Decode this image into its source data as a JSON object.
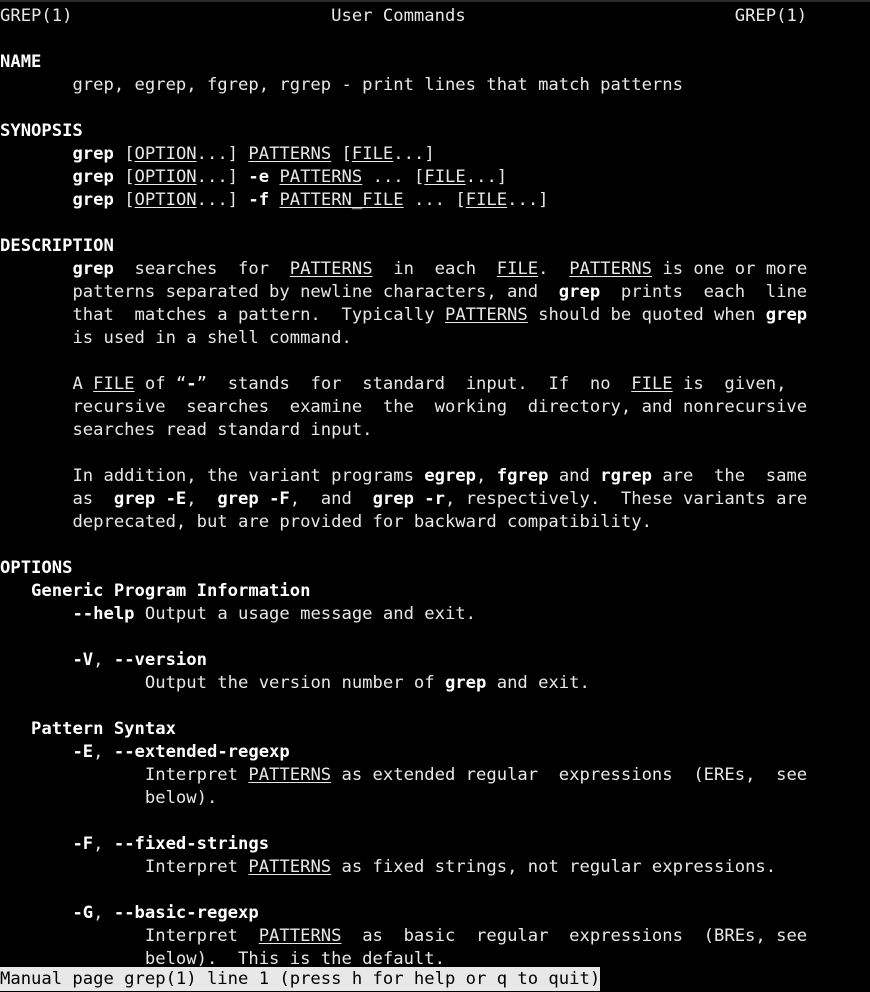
{
  "terminal": {
    "colors": {
      "background": "#000000",
      "foreground": "#e8e8e8",
      "status_background": "#e8e8e8",
      "status_foreground": "#000000"
    },
    "columns": 80,
    "rows": 43
  },
  "manpage": {
    "header": {
      "left": "GREP(1)",
      "center": "User Commands",
      "right": "GREP(1)"
    },
    "sections": {
      "name_heading": "NAME",
      "name_body": "grep, egrep, fgrep, rgrep - print lines that match patterns",
      "synopsis_heading": "SYNOPSIS",
      "description_heading": "DESCRIPTION",
      "options_heading": "OPTIONS",
      "generic_program_information": "Generic Program Information",
      "pattern_syntax": "Pattern Syntax"
    },
    "synopsis": {
      "line1": {
        "cmd": "grep",
        "opt": "OPTION",
        "rest1": "...] ",
        "pat": "PATTERNS",
        "rest2": " [",
        "file": "FILE",
        "rest3": "...]"
      },
      "line2": {
        "cmd": "grep",
        "opt": "OPTION",
        "flag": "-e",
        "pat": "PATTERNS",
        "file": "FILE"
      },
      "line3": {
        "cmd": "grep",
        "opt": "OPTION",
        "flag": "-f",
        "pat": "PATTERN_FILE",
        "file": "FILE"
      }
    },
    "description": {
      "p1": {
        "l1_a": "grep",
        "l1_b": "  searches  for  ",
        "l1_c": "PATTERNS",
        "l1_d": "  in  each  ",
        "l1_e": "FILE",
        "l1_f": ".  ",
        "l1_g": "PATTERNS",
        "l1_h": " is one or more",
        "l2_a": "patterns separated by newline characters, and  ",
        "l2_b": "grep",
        "l2_c": "  prints  each  line",
        "l3_a": "that  matches a pattern.  Typically ",
        "l3_b": "PATTERNS",
        "l3_c": " should be quoted when ",
        "l3_d": "grep",
        "l4_a": "is used in a shell command."
      },
      "p2": {
        "l1_a": "A ",
        "l1_b": "FILE",
        "l1_c": " of “",
        "l1_d": "-",
        "l1_e": "”  stands  for  standard  input.  If  no  ",
        "l1_f": "FILE",
        "l1_g": " is  given,",
        "l2_a": "recursive  searches  examine  the  working  directory, and nonrecursive",
        "l3_a": "searches read standard input."
      },
      "p3": {
        "l1_a": "In addition, the variant programs ",
        "l1_b": "egrep",
        "l1_c": ", ",
        "l1_d": "fgrep",
        "l1_e": " and ",
        "l1_f": "rgrep",
        "l1_g": " are  the  same",
        "l2_a": "as  ",
        "l2_b": "grep -E",
        "l2_c": ",  ",
        "l2_d": "grep -F",
        "l2_e": ",  and  ",
        "l2_f": "grep -r",
        "l2_g": ", respectively.  These variants are",
        "l3_a": "deprecated, but are provided for backward compatibility."
      }
    },
    "options": [
      {
        "flag": "--help",
        "desc_inline": " Output a usage message and exit."
      },
      {
        "flag_short": "-V",
        "flag_sep": ", ",
        "flag_long": "--version",
        "desc_a": "Output the version number of ",
        "desc_b": "grep",
        "desc_c": " and exit."
      },
      {
        "flag_short": "-E",
        "flag_sep": ", ",
        "flag_long": "--extended-regexp",
        "desc_l1_a": "Interpret ",
        "desc_l1_b": "PATTERNS",
        "desc_l1_c": " as extended regular  expressions  (EREs,  see",
        "desc_l2": "below)."
      },
      {
        "flag_short": "-F",
        "flag_sep": ", ",
        "flag_long": "--fixed-strings",
        "desc_l1_a": "Interpret ",
        "desc_l1_b": "PATTERNS",
        "desc_l1_c": " as fixed strings, not regular expressions."
      },
      {
        "flag_short": "-G",
        "flag_sep": ", ",
        "flag_long": "--basic-regexp",
        "desc_l1_a": "Interpret  ",
        "desc_l1_b": "PATTERNS",
        "desc_l1_c": "  as  basic  regular  expressions  (BREs, see",
        "desc_l2": "below).  This is the default."
      }
    ]
  },
  "statusbar": {
    "text": "Manual page grep(1) line 1 (press h for help or q to quit)"
  }
}
